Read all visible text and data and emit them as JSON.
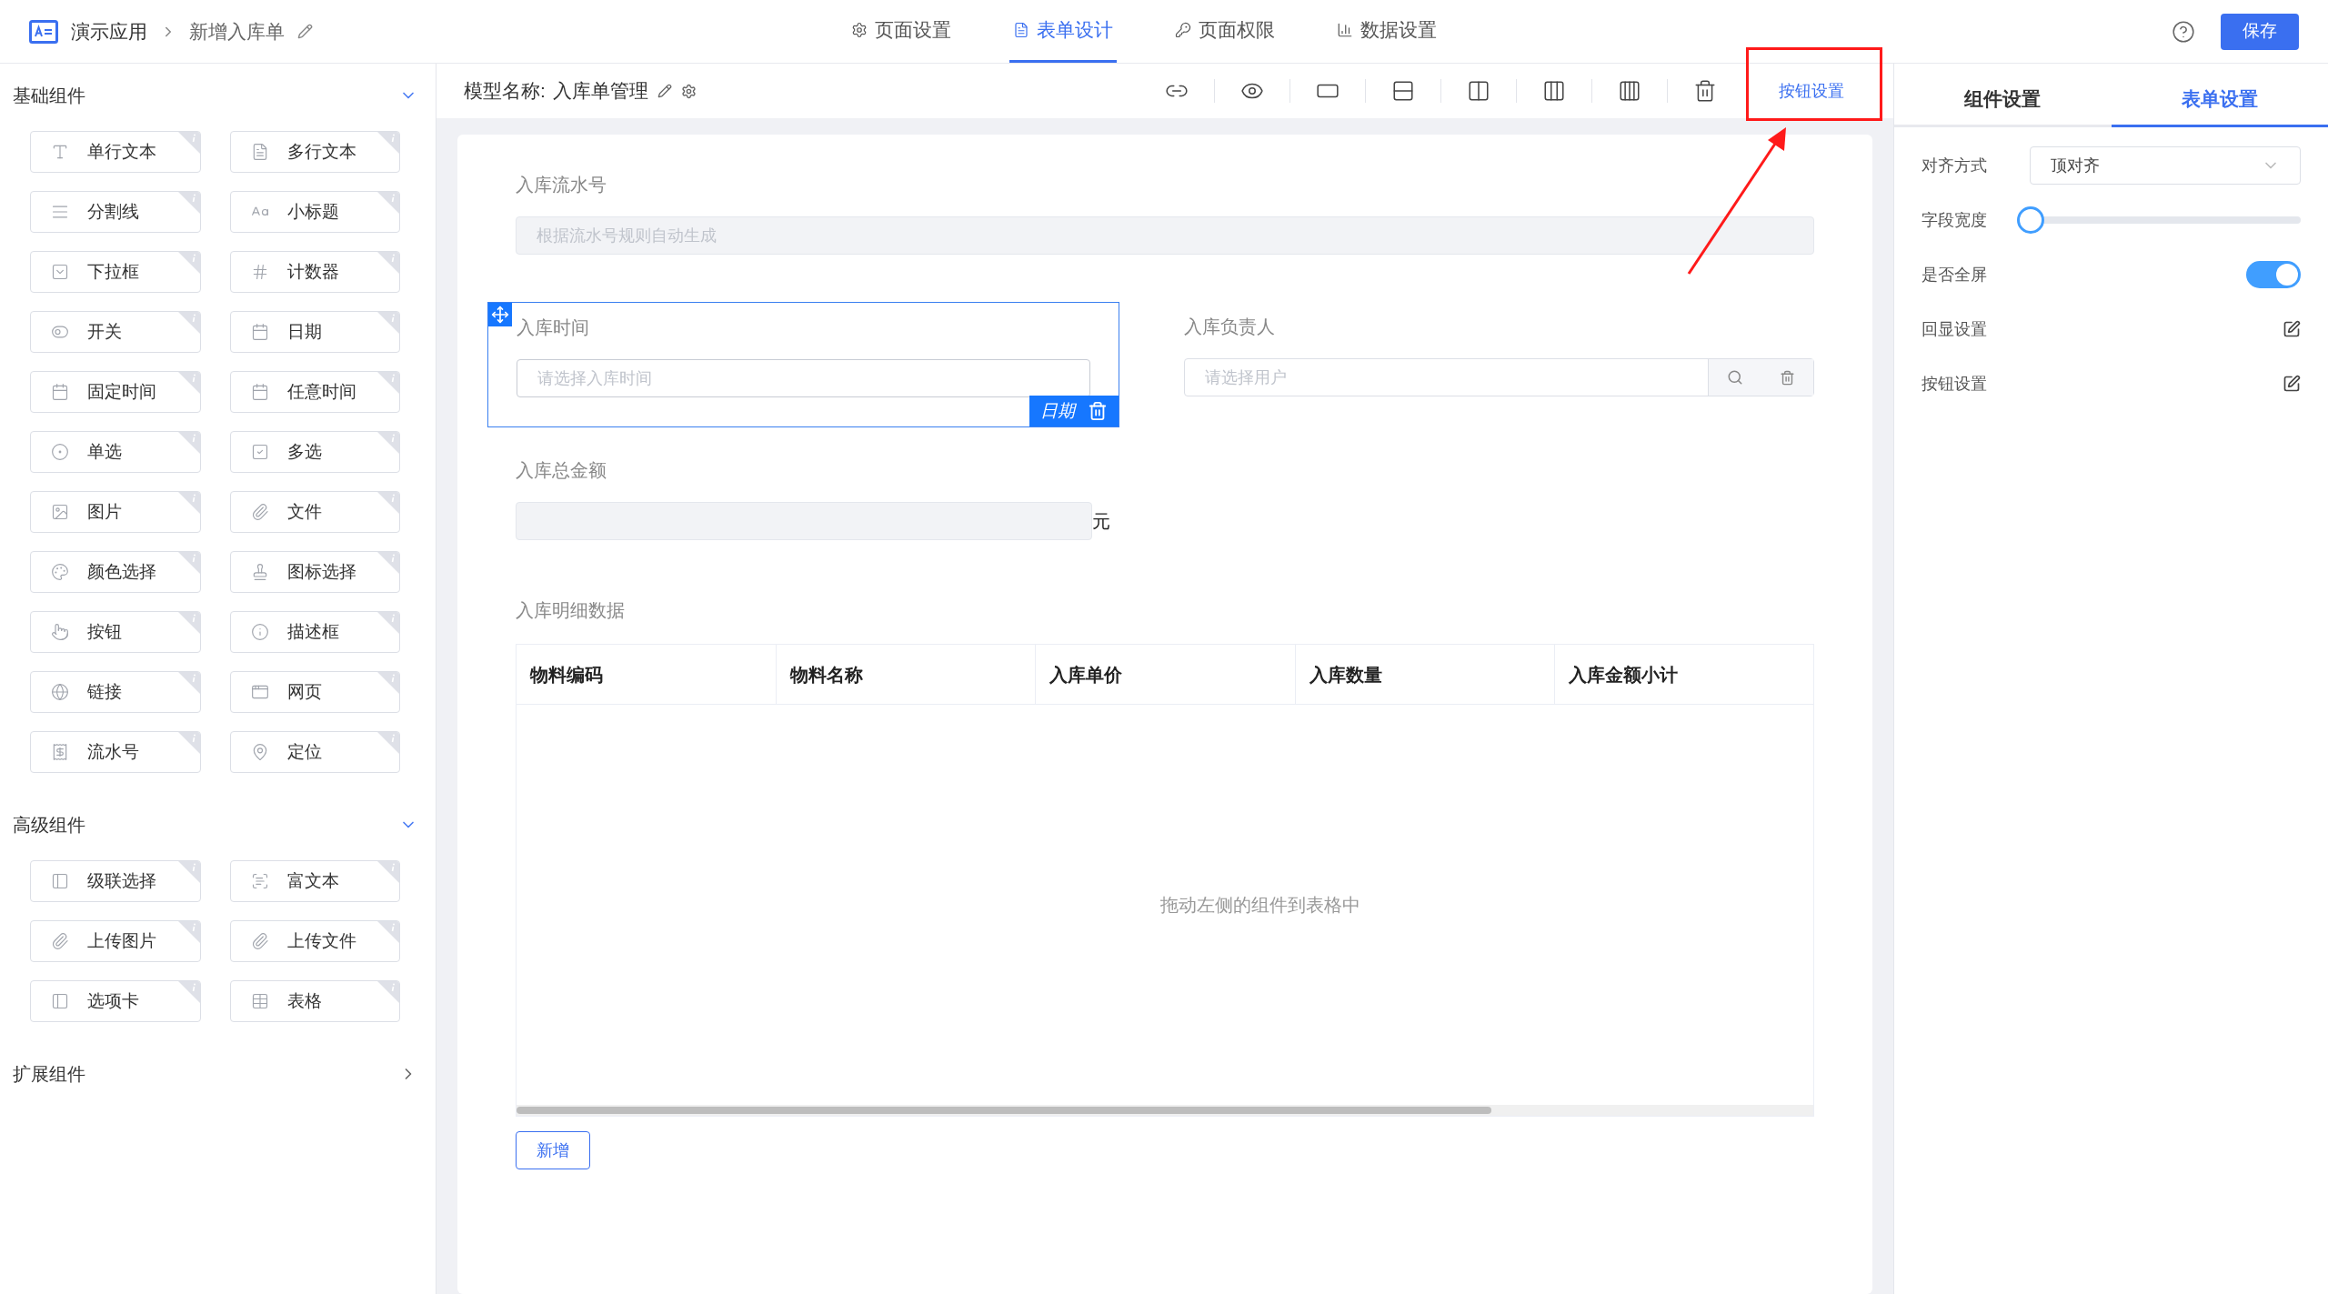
{
  "header": {
    "app_name": "演示应用",
    "breadcrumb": "新增入库单",
    "save": "保存"
  },
  "top_tabs": [
    {
      "label": "页面设置",
      "kind": "settings",
      "selected": false
    },
    {
      "label": "表单设计",
      "kind": "form",
      "selected": true
    },
    {
      "label": "页面权限",
      "kind": "permission",
      "selected": false
    },
    {
      "label": "数据设置",
      "kind": "data",
      "selected": false
    }
  ],
  "component_sections": [
    {
      "title": "基础组件",
      "expanded": true,
      "items": [
        {
          "label": "单行文本",
          "kind": "text"
        },
        {
          "label": "多行文本",
          "kind": "textarea"
        },
        {
          "label": "分割线",
          "kind": "divider"
        },
        {
          "label": "小标题",
          "kind": "subtitle"
        },
        {
          "label": "下拉框",
          "kind": "dropdown"
        },
        {
          "label": "计数器",
          "kind": "counter"
        },
        {
          "label": "开关",
          "kind": "switch"
        },
        {
          "label": "日期",
          "kind": "date"
        },
        {
          "label": "固定时间",
          "kind": "date"
        },
        {
          "label": "任意时间",
          "kind": "date"
        },
        {
          "label": "单选",
          "kind": "radio"
        },
        {
          "label": "多选",
          "kind": "checkbox"
        },
        {
          "label": "图片",
          "kind": "image"
        },
        {
          "label": "文件",
          "kind": "attach"
        },
        {
          "label": "颜色选择",
          "kind": "color"
        },
        {
          "label": "图标选择",
          "kind": "stamp"
        },
        {
          "label": "按钮",
          "kind": "button"
        },
        {
          "label": "描述框",
          "kind": "info"
        },
        {
          "label": "链接",
          "kind": "globe"
        },
        {
          "label": "网页",
          "kind": "window"
        },
        {
          "label": "流水号",
          "kind": "serial"
        },
        {
          "label": "定位",
          "kind": "location"
        }
      ]
    },
    {
      "title": "高级组件",
      "expanded": true,
      "items": [
        {
          "label": "级联选择",
          "kind": "panel"
        },
        {
          "label": "富文本",
          "kind": "richtext"
        },
        {
          "label": "上传图片",
          "kind": "attach"
        },
        {
          "label": "上传文件",
          "kind": "attach"
        },
        {
          "label": "选项卡",
          "kind": "panel"
        },
        {
          "label": "表格",
          "kind": "table"
        }
      ]
    },
    {
      "title": "扩展组件",
      "expanded": false
    }
  ],
  "toolbar": {
    "model_label": "模型名称:",
    "model_name": "入库单管理",
    "tools": [
      {
        "kind": "link"
      },
      {
        "kind": "preview"
      },
      {
        "kind": "ratio"
      },
      {
        "kind": "rows"
      },
      {
        "kind": "col2"
      },
      {
        "kind": "col3"
      },
      {
        "kind": "col4"
      },
      {
        "kind": "delete"
      }
    ],
    "button_settings": "按钮设置"
  },
  "form": {
    "serial": {
      "label": "入库流水号",
      "placeholder": "根据流水号规则自动生成",
      "disabled": true
    },
    "date": {
      "label": "入库时间",
      "placeholder": "请选择入库时间",
      "selected": true,
      "badge": "日期"
    },
    "user": {
      "label": "入库负责人",
      "placeholder": "请选择用户"
    },
    "amount": {
      "label": "入库总金额",
      "unit": "元",
      "disabled": true
    },
    "detail": {
      "label": "入库明细数据",
      "columns": [
        "物料编码",
        "物料名称",
        "入库单价",
        "入库数量",
        "入库金额小计"
      ],
      "empty_text": "拖动左侧的组件到表格中",
      "add_button": "新增"
    }
  },
  "settings_tabs": [
    {
      "label": "组件设置",
      "selected": false
    },
    {
      "label": "表单设置",
      "selected": true
    }
  ],
  "settings": [
    {
      "kind": "select",
      "label": "对齐方式",
      "value": "顶对齐"
    },
    {
      "kind": "slider",
      "label": "字段宽度",
      "level": 0
    },
    {
      "kind": "switch",
      "label": "是否全屏",
      "on": true
    },
    {
      "kind": "edit",
      "label": "回显设置"
    },
    {
      "kind": "edit",
      "label": "按钮设置"
    }
  ]
}
